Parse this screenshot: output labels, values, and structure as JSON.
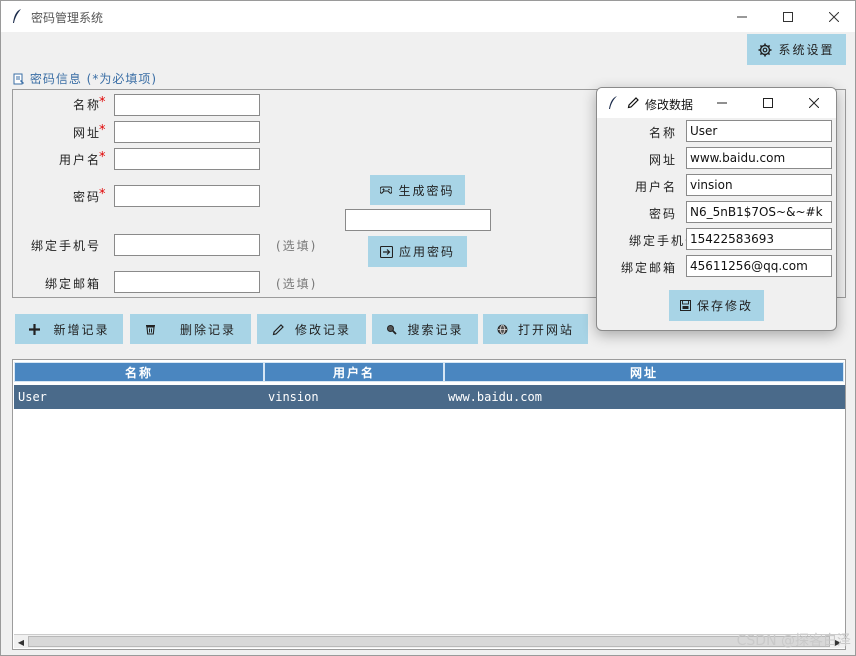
{
  "window": {
    "title": "密码管理系统",
    "minimize": "—",
    "maximize": "☐",
    "close": "✕"
  },
  "settings_button": {
    "label": "系统设置",
    "icon": "gear-icon"
  },
  "form": {
    "section_title": "密码信息 (*为必填项)",
    "section_icon": "document-icon",
    "required_mark": "*",
    "fields": {
      "name": {
        "label": "名称",
        "value": ""
      },
      "url": {
        "label": "网址",
        "value": ""
      },
      "username": {
        "label": "用户名",
        "value": ""
      },
      "password": {
        "label": "密码",
        "value": ""
      },
      "phone": {
        "label": "绑定手机号",
        "value": "",
        "hint": "(选填)"
      },
      "email": {
        "label": "绑定邮箱",
        "value": "",
        "hint": "(选填)"
      }
    },
    "generate_button": {
      "label": "生成密码",
      "icon": "gamepad-icon"
    },
    "generated_value": "",
    "apply_button": {
      "label": "应用密码",
      "icon": "apply-icon"
    }
  },
  "toolbar": {
    "add": {
      "label": "新增记录",
      "icon": "plus-icon"
    },
    "delete": {
      "label": "删除记录",
      "icon": "trash-icon"
    },
    "edit": {
      "label": "修改记录",
      "icon": "pencil-icon"
    },
    "search": {
      "label": "搜索记录",
      "icon": "search-icon"
    },
    "open": {
      "label": "打开网站",
      "icon": "globe-icon"
    }
  },
  "table": {
    "columns": [
      "名称",
      "用户名",
      "网址"
    ],
    "rows": [
      [
        "User",
        "vinsion",
        "www.baidu.com"
      ]
    ]
  },
  "dialog": {
    "title": "修改数据",
    "fields": [
      {
        "label": "名称",
        "value": "User"
      },
      {
        "label": "网址",
        "value": "www.baidu.com"
      },
      {
        "label": "用户名",
        "value": "vinsion"
      },
      {
        "label": "密码",
        "value": "N6_5nB1$7OS~&~#k"
      },
      {
        "label": "绑定手机号",
        "value": "15422583693"
      },
      {
        "label": "绑定邮箱",
        "value": "45611256@qq.com"
      }
    ],
    "save_button": {
      "label": "保存修改",
      "icon": "save-icon"
    }
  },
  "watermark": "CSDN @探客白泽",
  "colors": {
    "button_bg": "#a8d4e6",
    "header_bg": "#4a86c0",
    "selected_row": "#4a6a8a",
    "required": "#e00000",
    "section_title": "#3a6ea5"
  }
}
